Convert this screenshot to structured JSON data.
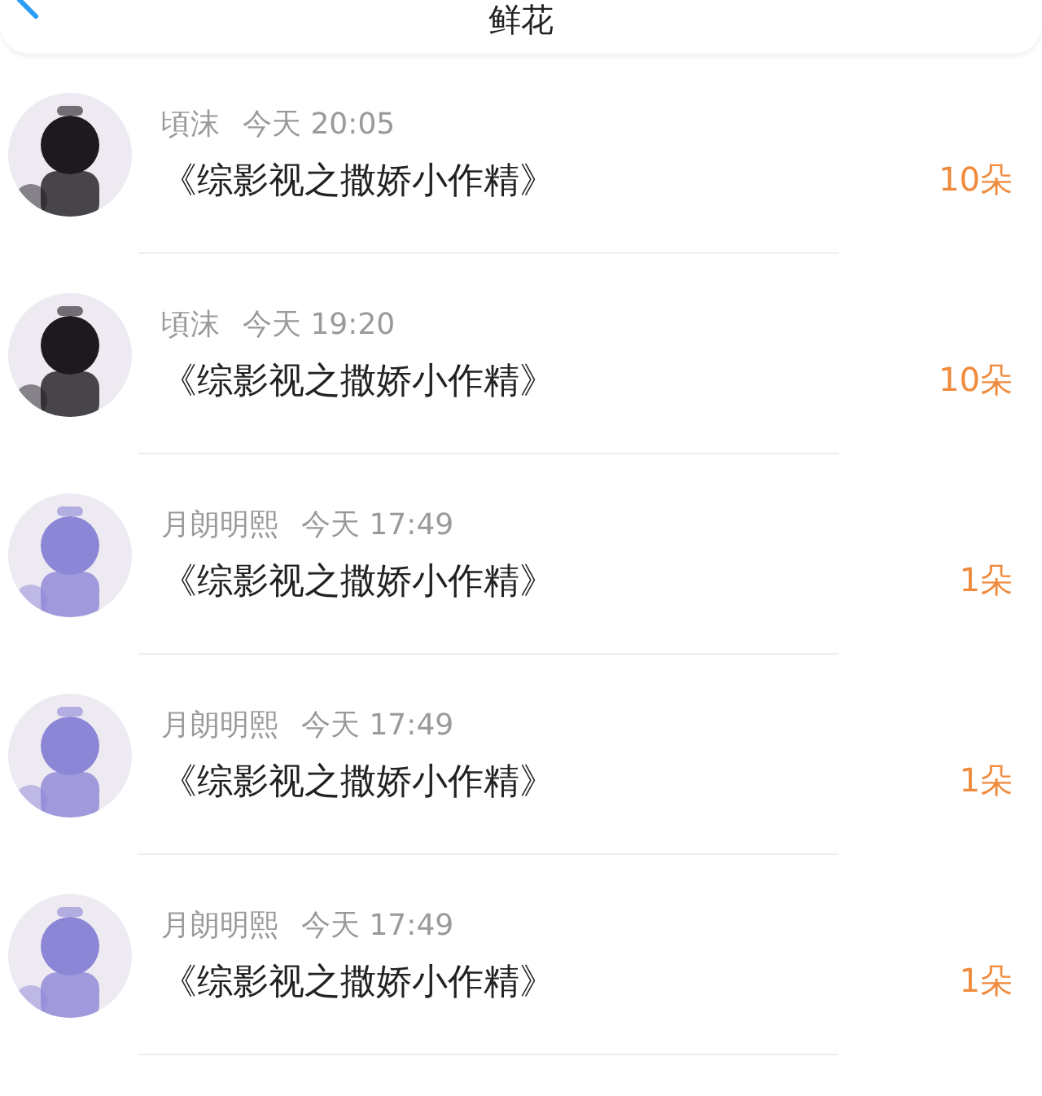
{
  "header": {
    "title": "鲜花"
  },
  "rows": [
    {
      "name": "頃沫",
      "time": "今天 20:05",
      "book": "《综影视之撒娇小作精》",
      "count": "10朵"
    },
    {
      "name": "頃沫",
      "time": "今天 19:20",
      "book": "《综影视之撒娇小作精》",
      "count": "10朵"
    },
    {
      "name": "月朗明熙",
      "time": "今天 17:49",
      "book": "《综影视之撒娇小作精》",
      "count": "1朵"
    },
    {
      "name": "月朗明熙",
      "time": "今天 17:49",
      "book": "《综影视之撒娇小作精》",
      "count": "1朵"
    },
    {
      "name": "月朗明熙",
      "time": "今天 17:49",
      "book": "《综影视之撒娇小作精》",
      "count": "1朵"
    }
  ]
}
